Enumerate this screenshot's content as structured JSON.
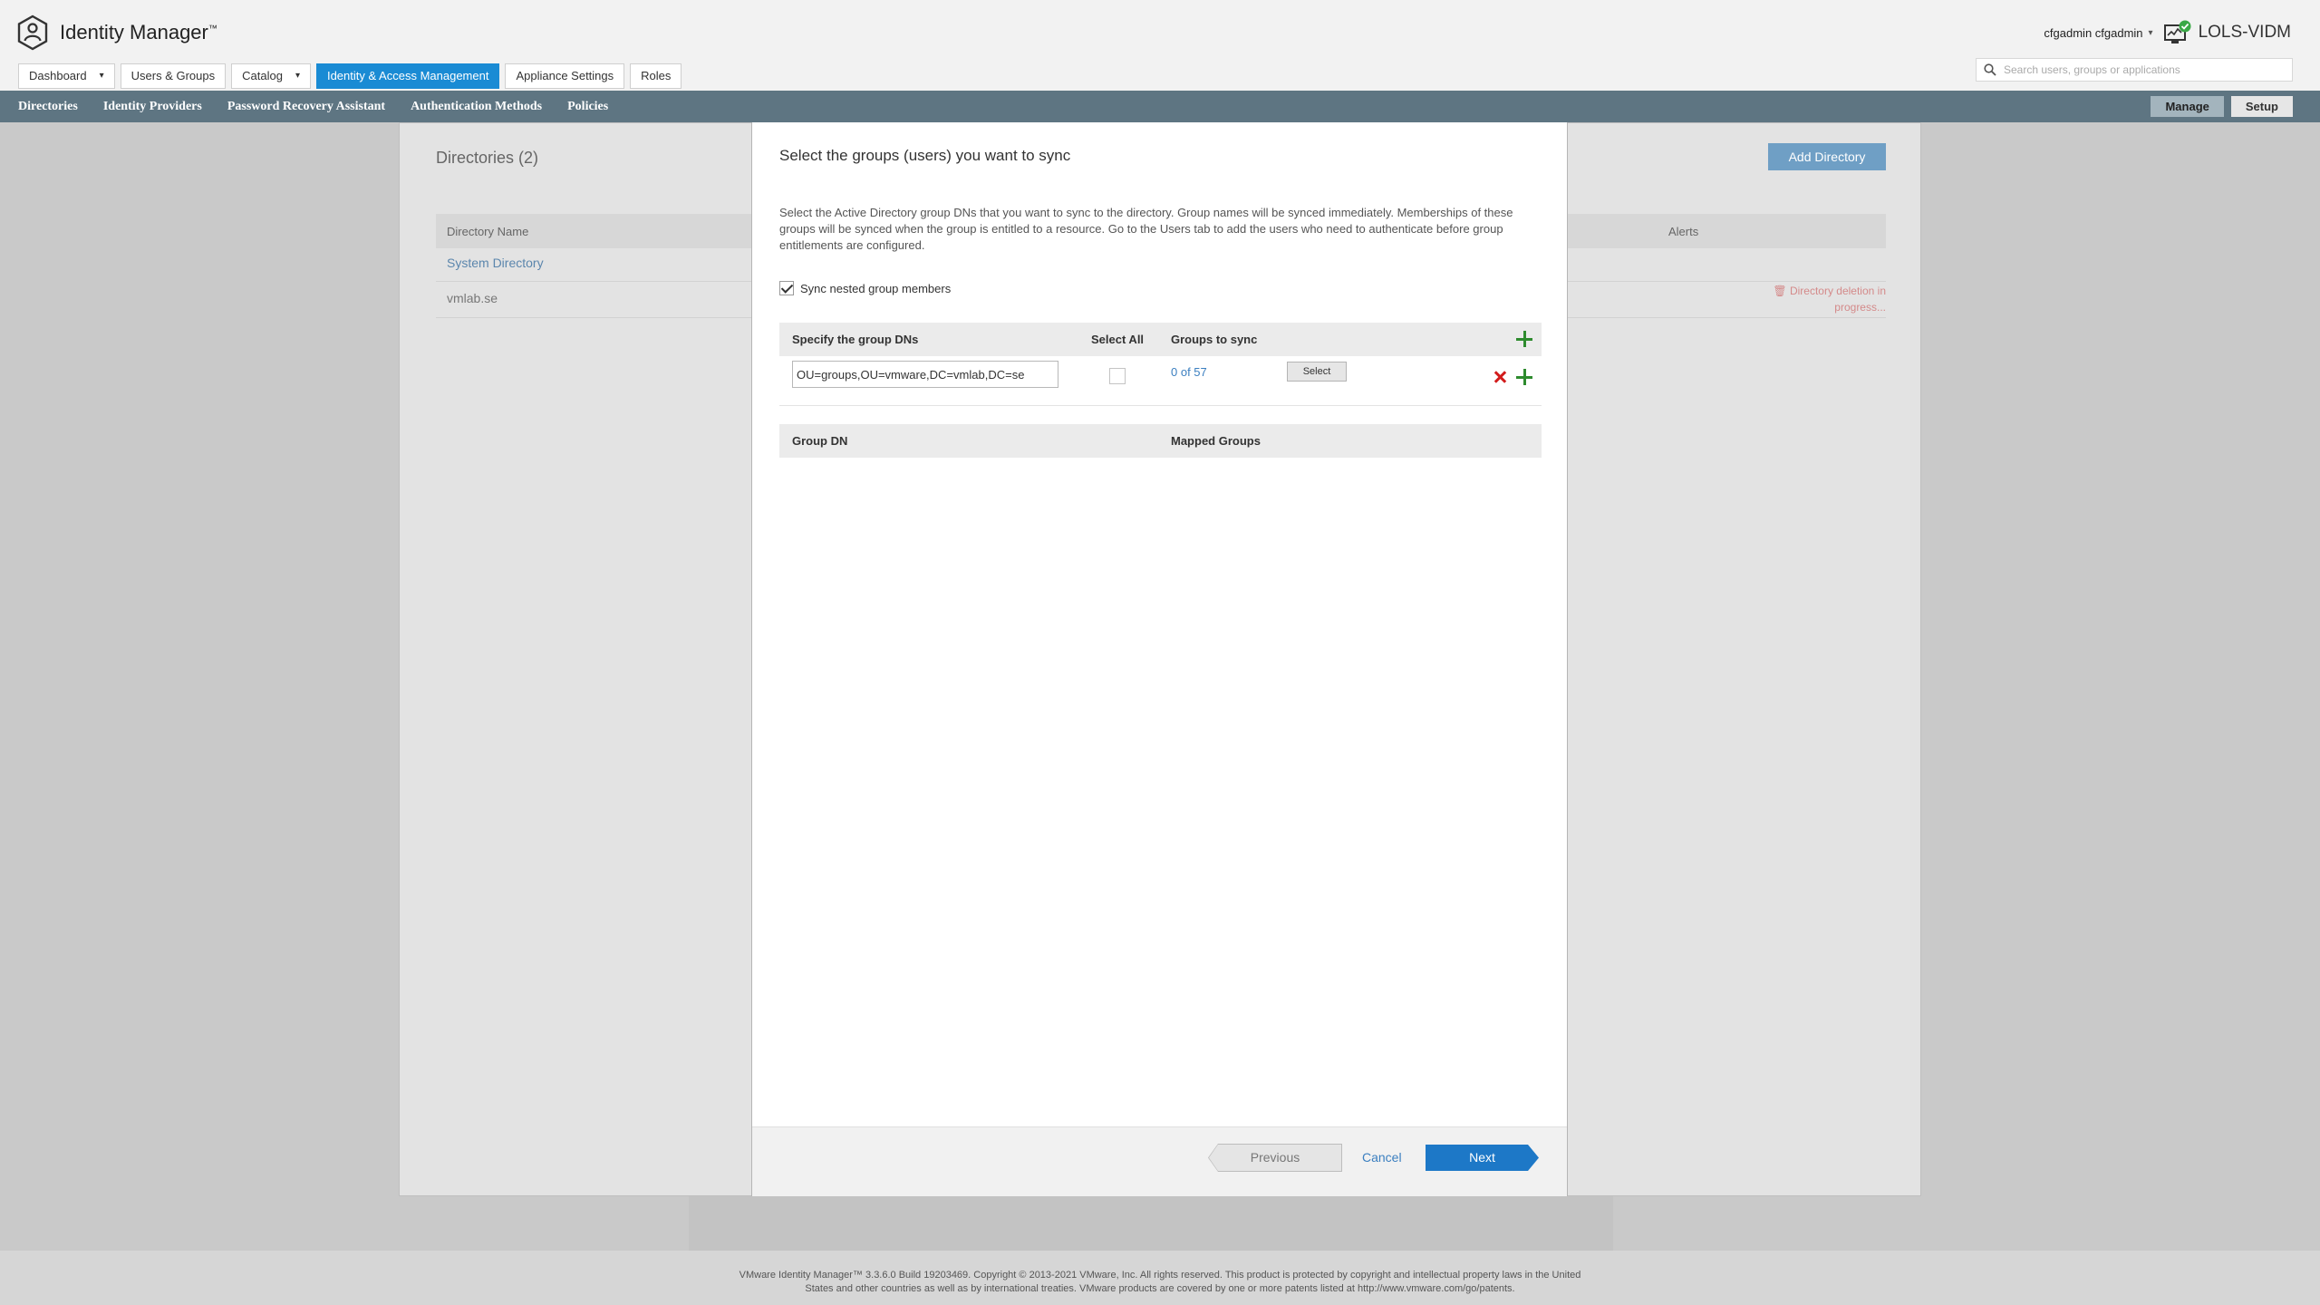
{
  "app": {
    "name": "Identity Manager",
    "trademark": "™",
    "user": "cfgadmin cfgadmin",
    "host": "LOLS-VIDM"
  },
  "nav": {
    "tabs": [
      {
        "label": "Dashboard",
        "has_menu": true
      },
      {
        "label": "Users & Groups",
        "has_menu": false
      },
      {
        "label": "Catalog",
        "has_menu": true
      },
      {
        "label": "Identity & Access Management",
        "has_menu": false,
        "active": true
      },
      {
        "label": "Appliance Settings",
        "has_menu": false
      },
      {
        "label": "Roles",
        "has_menu": false
      }
    ],
    "search_placeholder": "Search users, groups or applications"
  },
  "subnav": {
    "items": [
      "Directories",
      "Identity Providers",
      "Password Recovery Assistant",
      "Authentication Methods",
      "Policies"
    ],
    "manage_label": "Manage",
    "setup_label": "Setup"
  },
  "background_page": {
    "title": "Directories (2)",
    "add_button": "Add Directory",
    "columns": {
      "name": "Directory Name",
      "alerts": "Alerts"
    },
    "rows": [
      "System Directory",
      "vmlab.se"
    ],
    "alert": "Directory deletion in progress..."
  },
  "modal": {
    "title": "Select the groups (users) you want to sync",
    "description": "Select the Active Directory group DNs that you want to sync to the directory. Group names will be synced immediately. Memberships of these groups will be synced when the group is entitled to a resource. Go to the Users tab to add the users who need to authenticate before group entitlements are configured.",
    "sync_nested_label": "Sync nested group members",
    "sync_nested_checked": true,
    "table": {
      "col_dn": "Specify the group DNs",
      "col_select_all": "Select All",
      "col_groups": "Groups to sync",
      "rows": [
        {
          "dn": "OU=groups,OU=vmware,DC=vmlab,DC=se",
          "groups": "0 of 57",
          "select_label": "Select"
        }
      ]
    },
    "mapping": {
      "col_group_dn": "Group DN",
      "col_mapped": "Mapped Groups"
    },
    "buttons": {
      "previous": "Previous",
      "cancel": "Cancel",
      "next": "Next"
    }
  },
  "footer": {
    "line1": "VMware Identity Manager™ 3.3.6.0 Build 19203469. Copyright © 2013-2021 VMware, Inc. All rights reserved. This product is protected by copyright and intellectual property laws in the United",
    "line2": "States and other countries as well as by international treaties. VMware products are covered by one or more patents listed at http://www.vmware.com/go/patents."
  },
  "colors": {
    "accent": "#1a8bd4",
    "subnav_bg": "#5e7582",
    "next_button": "#1d78c7",
    "delete_icon": "#d21c1c",
    "add_icon": "#2e8b2e"
  }
}
